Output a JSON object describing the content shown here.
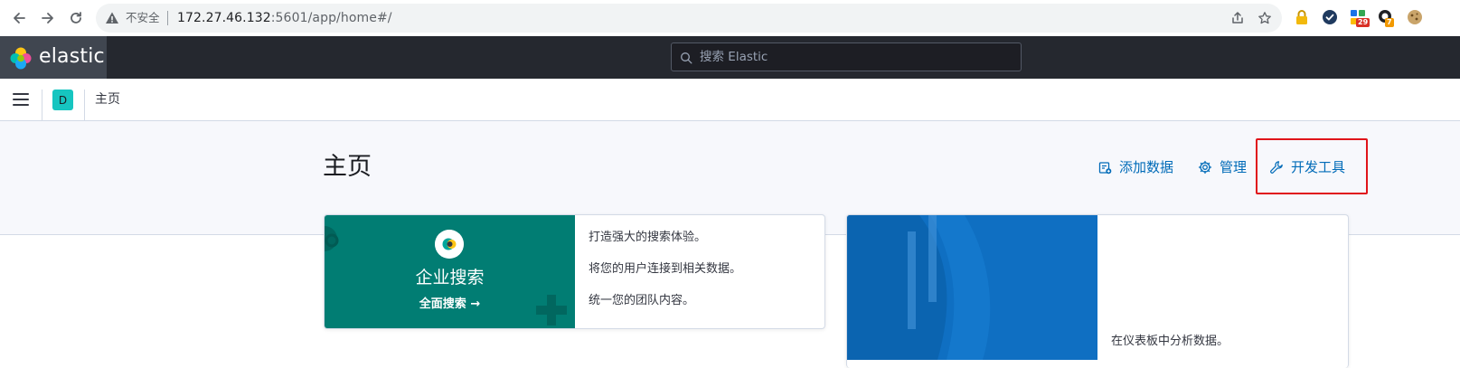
{
  "browser": {
    "insecure_label": "不安全",
    "url_host": "172.27.46.132",
    "url_rest": ":5601/app/home#/",
    "extension_badges": {
      "ext3": "29",
      "ext4": "7"
    }
  },
  "header": {
    "brand": "elastic",
    "search_placeholder": "搜索 Elastic"
  },
  "breadcrumb_bar": {
    "space_initial": "D",
    "crumb": "主页"
  },
  "page": {
    "title": "主页",
    "actions": [
      {
        "label": "添加数据",
        "icon": "add-data-icon"
      },
      {
        "label": "管理",
        "icon": "gear-icon"
      },
      {
        "label": "开发工具",
        "icon": "wrench-icon"
      }
    ]
  },
  "cards": {
    "enterprise": {
      "title": "企业搜索",
      "link": "全面搜索",
      "lines": [
        "打造强大的搜索体验。",
        "将您的用户连接到相关数据。",
        "统一您的团队内容。"
      ]
    },
    "observability": {
      "line": "在仪表板中分析数据。"
    }
  },
  "colors": {
    "header_bg": "#25282f",
    "accent_link": "#006bb8",
    "enterprise_green": "#017d73",
    "observability_blue": "#0f6fc2",
    "highlight_red": "#e0141a"
  }
}
